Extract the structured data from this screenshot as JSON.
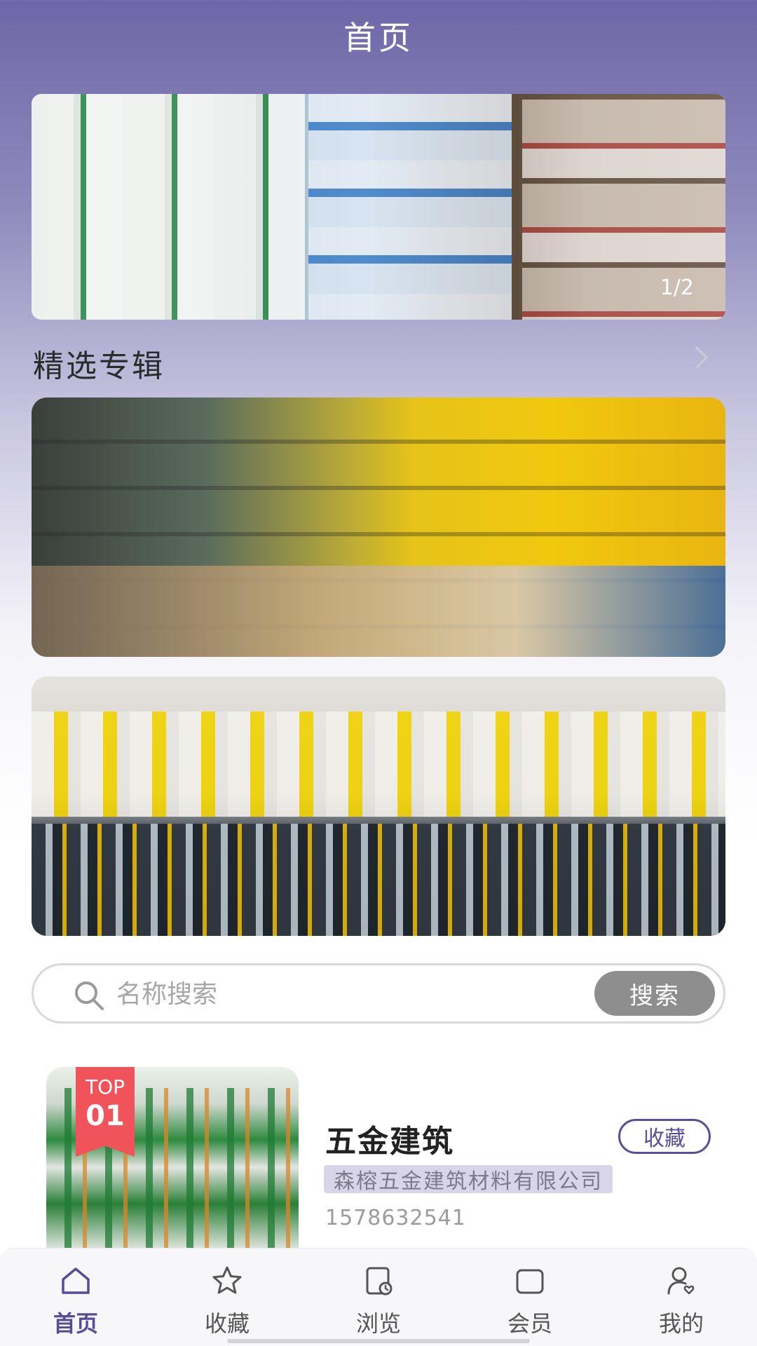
{
  "header": {
    "title": "首页"
  },
  "banner": {
    "indicator": "1/2"
  },
  "section": {
    "title": "精选专辑"
  },
  "search": {
    "placeholder": "名称搜索",
    "button_label": "搜索"
  },
  "list": {
    "items": [
      {
        "rank_top": "TOP",
        "rank_num": "01",
        "title": "五金建筑",
        "fav_label": "收藏",
        "company": "森榕五金建筑材料有限公司",
        "phone": "1578632541"
      }
    ]
  },
  "tabbar": {
    "tabs": [
      {
        "label": "首页",
        "icon": "home-icon",
        "active": true
      },
      {
        "label": "收藏",
        "icon": "star-icon",
        "active": false
      },
      {
        "label": "浏览",
        "icon": "history-icon",
        "active": false
      },
      {
        "label": "会员",
        "icon": "member-icon",
        "active": false
      },
      {
        "label": "我的",
        "icon": "profile-icon",
        "active": false
      }
    ]
  },
  "colors": {
    "accent": "#574c95",
    "header_gradient_top": "#6e67a8",
    "badge_red": "#f0545a",
    "tag_bg": "#d8d5ea"
  }
}
